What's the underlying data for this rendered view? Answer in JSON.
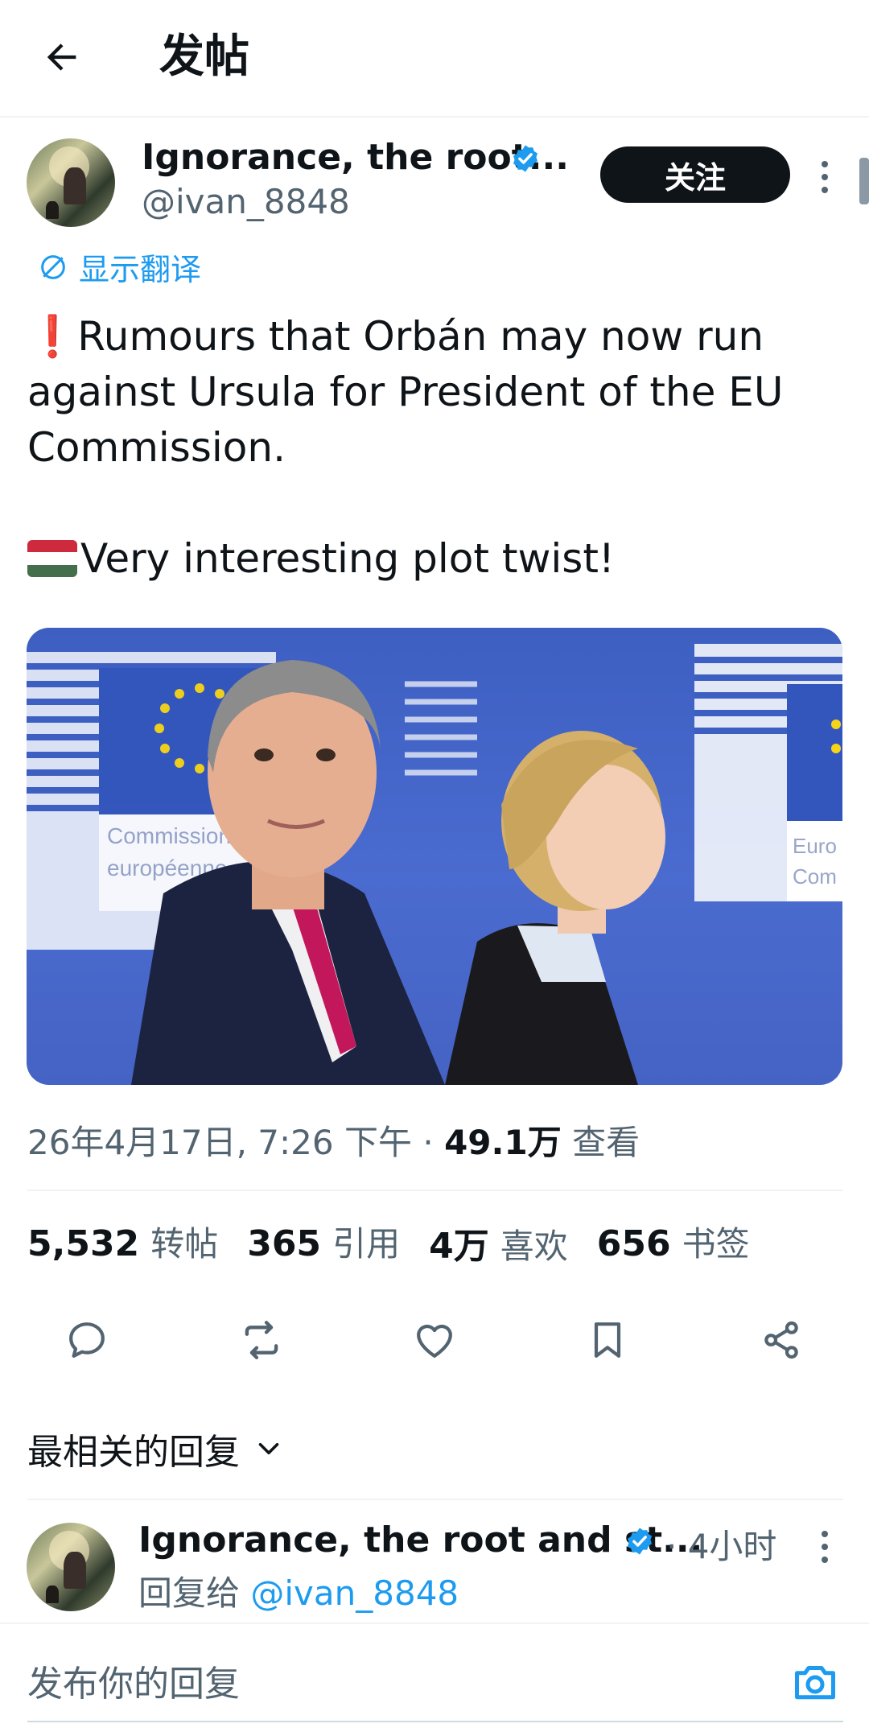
{
  "header": {
    "title": "发帖"
  },
  "post": {
    "author": {
      "name": "Ignorance, the root...",
      "handle": "@ivan_8848",
      "verified": true
    },
    "follow_label": "关注",
    "translate_label": "显示翻译",
    "text_lines": [
      "❗Rumours that Orbán may now run",
      "against Ursula for President of the EU",
      "Commission.",
      "",
      "Very interesting plot twist!"
    ],
    "image_signs": {
      "left": [
        "Commission",
        "européenne"
      ],
      "right": [
        "Euro",
        "Com"
      ]
    },
    "timestamp": "26年4月17日, 7:26 下午",
    "separator": "·",
    "views": "49.1万",
    "views_label": "查看",
    "stats": [
      {
        "value": "5,532",
        "label": "转帖"
      },
      {
        "value": "365",
        "label": "引用"
      },
      {
        "value": "4万",
        "label": "喜欢"
      },
      {
        "value": "656",
        "label": "书签"
      }
    ]
  },
  "actions": [
    "reply-icon",
    "repost-icon",
    "like-icon",
    "bookmark-icon",
    "share-icon"
  ],
  "replies": {
    "sort_label": "最相关的回复",
    "items": [
      {
        "name": "Ignorance, the root and st...",
        "verified": true,
        "time": "· 4小时",
        "reply_prefix": "回复给",
        "reply_to": "@ivan_8848"
      }
    ]
  },
  "composer": {
    "placeholder": "发布你的回复"
  },
  "colors": {
    "accent": "#1d9bf0",
    "text": "#0f1419",
    "muted": "#536471",
    "alert": "#e0243c",
    "eu_blue": "#3e5fc2"
  }
}
